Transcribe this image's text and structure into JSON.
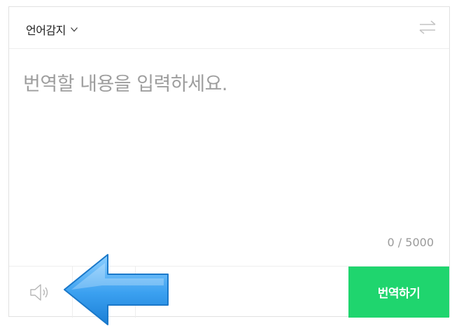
{
  "source_language": {
    "label": "언어감지",
    "icon": "chevron-down-icon"
  },
  "swap": {
    "icon": "swap-arrows-icon"
  },
  "input": {
    "value": "",
    "placeholder": "번역할 내용을 입력하세요."
  },
  "counter": {
    "text": "0 / 5000"
  },
  "footer": {
    "speaker_icon": "speaker-icon",
    "translate_label": "번역하기"
  },
  "colors": {
    "accent_green": "#1fd56e",
    "annotation_arrow": "#3aa0f0"
  }
}
